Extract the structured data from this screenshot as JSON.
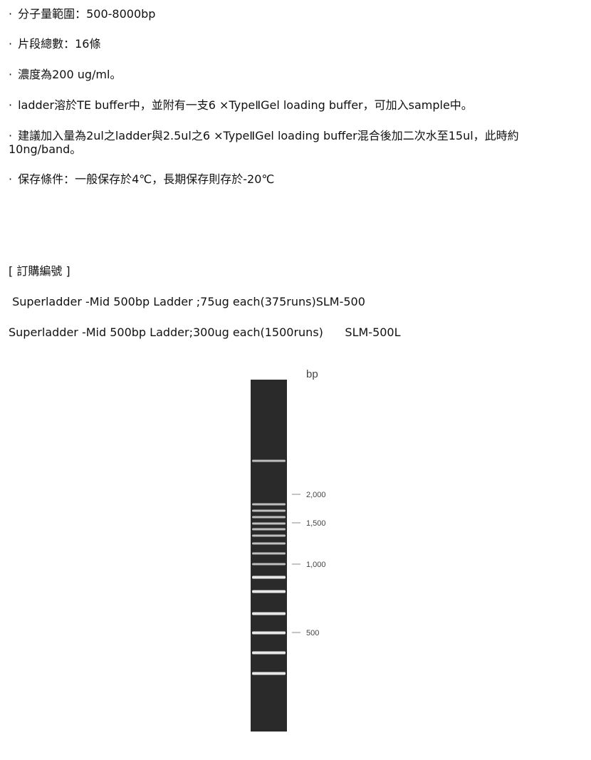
{
  "specs": [
    {
      "bullet": "·",
      "text": "分子量範圍：500-8000bp"
    },
    {
      "bullet": "·",
      "text": "片段總數：16條"
    },
    {
      "bullet": "·",
      "text": "濃度為200 ug/ml。"
    },
    {
      "bullet": "·",
      "text": "ladder溶於TE buffer中，並附有一支6 ×TypeⅡGel loading buffer，可加入sample中。"
    },
    {
      "bullet": "·",
      "text": "建議加入量為2ul之ladder與2.5ul之6 ×TypeⅡGel loading buffer混合後加二次水至15ul，此時約10ng/band。"
    },
    {
      "bullet": "·",
      "text": "保存條件：一般保存於4℃，長期保存則存於-20℃"
    }
  ],
  "order": {
    "heading": "[ 訂購編號 ]",
    "items": [
      {
        "text": " Superladder -Mid 500bp Ladder ;75ug each(375runs)SLM-500"
      },
      {
        "text": "Superladder -Mid 500bp Ladder;300ug each(1500runs)      SLM-500L"
      }
    ]
  },
  "gel": {
    "unit_label": "bp",
    "markers": [
      {
        "label": "2,000",
        "value": 2000
      },
      {
        "label": "1,500",
        "value": 1500
      },
      {
        "label": "1,000",
        "value": 1000
      },
      {
        "label": "500",
        "value": 500
      }
    ],
    "band_count": 16,
    "colors": {
      "lane": "#2a2a2a",
      "band": "#f2f2f2",
      "marker_text": "#444444"
    }
  }
}
